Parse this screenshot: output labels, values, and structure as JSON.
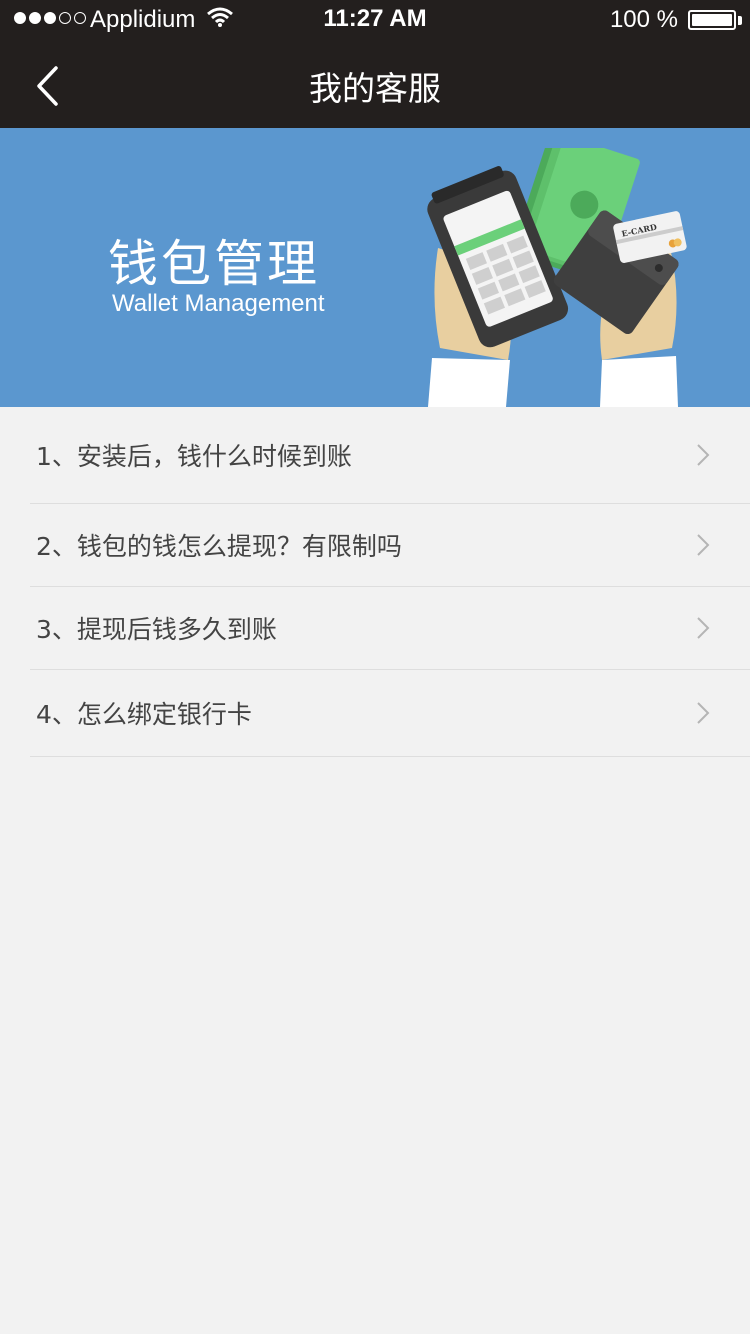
{
  "status_bar": {
    "carrier": "Applidium",
    "time": "11:27 AM",
    "battery": "100 %"
  },
  "nav": {
    "back_icon": "chevron-left-icon",
    "title": "我的客服"
  },
  "banner": {
    "title": "钱包管理",
    "subtitle": "Wallet Management",
    "card_label": "E-CARD"
  },
  "faq": [
    {
      "label": "1、安装后，钱什么时候到账"
    },
    {
      "label": "2、钱包的钱怎么提现？有限制吗"
    },
    {
      "label": "3、提现后钱多久到账"
    },
    {
      "label": "4、怎么绑定银行卡"
    }
  ],
  "colors": {
    "nav_bg": "#231f1e",
    "banner_bg": "#5b97cf",
    "page_bg": "#f2f2f2",
    "cash_green": "#6bd07a"
  }
}
